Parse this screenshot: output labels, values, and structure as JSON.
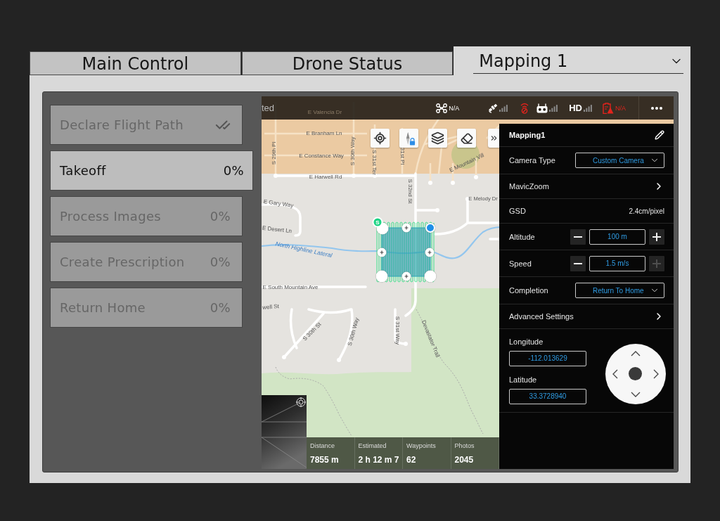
{
  "tabs": [
    {
      "label": "Main Control",
      "selected": false
    },
    {
      "label": "Drone Status",
      "selected": false
    },
    {
      "label": "Mapping 1",
      "selected": true
    }
  ],
  "steps": [
    {
      "label": "Declare Flight Path",
      "completed": true,
      "selected": false
    },
    {
      "label": "Takeoff",
      "progress": "0%",
      "completed": false,
      "selected": true
    },
    {
      "label": "Process Images",
      "progress": "0%",
      "completed": false,
      "selected": false
    },
    {
      "label": "Create Prescription",
      "progress": "0%",
      "completed": false,
      "selected": false
    },
    {
      "label": "Return Home",
      "progress": "0%",
      "completed": false,
      "selected": false
    }
  ],
  "mission_app": {
    "status_bar": {
      "connection_text": "ted",
      "items": [
        {
          "kind": "aircraft",
          "text": "N/A",
          "alert": false
        },
        {
          "kind": "gps",
          "alert": false
        },
        {
          "kind": "link",
          "alert": true
        },
        {
          "kind": "remote",
          "alert": false
        },
        {
          "kind": "hd",
          "text": "HD",
          "alert": false
        },
        {
          "kind": "flight_mode",
          "text": "N/A",
          "alert": true
        }
      ]
    },
    "map": {
      "street_labels": [
        {
          "text": "E Valencia Dr",
          "kind": "covered_street"
        },
        {
          "text": "E Branham Ln",
          "kind": "street"
        },
        {
          "text": "S 29th Pl",
          "kind": "street"
        },
        {
          "text": "S 30th Way",
          "kind": "street"
        },
        {
          "text": "E Constance Way",
          "kind": "street"
        },
        {
          "text": "S 31st Ter",
          "kind": "street"
        },
        {
          "text": "31st Pl",
          "kind": "street"
        },
        {
          "text": "E Mountain Vill",
          "kind": "street"
        },
        {
          "text": "E Harwell Rd",
          "kind": "street"
        },
        {
          "text": "S 32nd St",
          "kind": "street"
        },
        {
          "text": "E Melody Dr",
          "kind": "street"
        },
        {
          "text": "E Gary Way",
          "kind": "street"
        },
        {
          "text": "E Desert Ln",
          "kind": "street"
        },
        {
          "text": "North Highline Lateral",
          "kind": "water"
        },
        {
          "text": "E South Mountain Ave",
          "kind": "street"
        },
        {
          "text": "well St",
          "kind": "street"
        },
        {
          "text": "S 30th St",
          "kind": "street"
        },
        {
          "text": "S 30th Way",
          "kind": "street"
        },
        {
          "text": "S 31st Way",
          "kind": "street"
        },
        {
          "text": "Devastator Trail",
          "kind": "trail"
        }
      ],
      "flight_area": {
        "start_label": "S"
      }
    },
    "flight_stats": [
      {
        "label": "Distance",
        "value": "7855 m"
      },
      {
        "label": "Estimated",
        "value": "2 h 12 m 7"
      },
      {
        "label": "Waypoints",
        "value": "62"
      },
      {
        "label": "Photos",
        "value": "2045"
      }
    ],
    "mission_panel": {
      "title": "Mapping1",
      "settings": [
        {
          "kind": "dropdown",
          "label": "Camera Type",
          "value": "Custom Camera"
        },
        {
          "kind": "link",
          "label": "MavicZoom"
        },
        {
          "kind": "value",
          "label": "GSD",
          "value": "2.4cm/pixel"
        },
        {
          "kind": "stepper",
          "label": "Altitude",
          "value": "100 m",
          "increase_disabled": false
        },
        {
          "kind": "stepper",
          "label": "Speed",
          "value": "1.5 m/s",
          "increase_disabled": true
        },
        {
          "kind": "dropdown",
          "label": "Completion",
          "value": "Return To Home"
        },
        {
          "kind": "link",
          "label": "Advanced Settings"
        }
      ],
      "coordinates": [
        {
          "label": "Longitude",
          "value": "-112.013629"
        },
        {
          "label": "Latitude",
          "value": "33.3728940"
        }
      ]
    }
  }
}
